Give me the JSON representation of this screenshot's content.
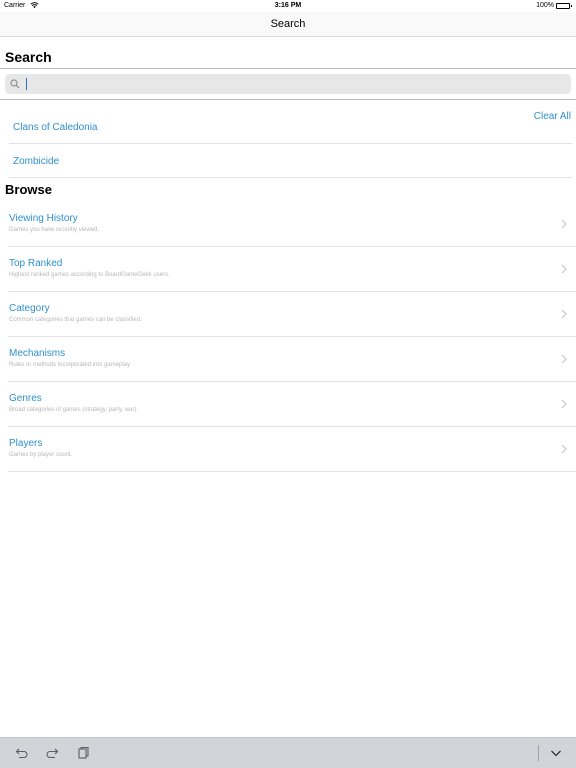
{
  "status_bar": {
    "carrier": "Carrier",
    "time": "3:16 PM",
    "battery": "100%"
  },
  "nav": {
    "title": "Search"
  },
  "search": {
    "header": "Search",
    "value": "",
    "placeholder": ""
  },
  "recent": {
    "clear_label": "Clear All",
    "items": [
      {
        "label": "Clans of Caledonia"
      },
      {
        "label": "Zombicide"
      }
    ]
  },
  "browse": {
    "header": "Browse",
    "items": [
      {
        "title": "Viewing History",
        "subtitle": "Games you have recently viewed."
      },
      {
        "title": "Top Ranked",
        "subtitle": "Highest ranked games according to BoardGameGeek users."
      },
      {
        "title": "Category",
        "subtitle": "Common categories that games can be classified."
      },
      {
        "title": "Mechanisms",
        "subtitle": "Rules or methods incorporated into gameplay"
      },
      {
        "title": "Genres",
        "subtitle": "Broad categories of games (strategy, party, war)."
      },
      {
        "title": "Players",
        "subtitle": "Games by player count."
      }
    ]
  },
  "icons": {
    "wifi": "wifi-icon",
    "battery": "battery-icon",
    "search": "magnifier-icon",
    "chevron": "chevron-right-icon",
    "undo": "undo-icon",
    "redo": "redo-icon",
    "paste": "paste-icon",
    "dismiss": "chevron-down-icon"
  },
  "colors": {
    "link": "#2f8fce",
    "subtitle": "#b8b8b8",
    "keyboard_bar": "#d1d4d9"
  }
}
